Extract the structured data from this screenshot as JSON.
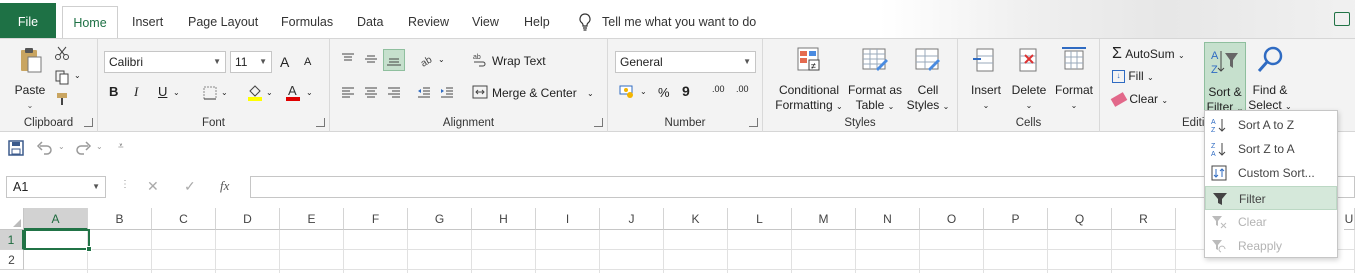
{
  "tabs": {
    "file": "File",
    "home": "Home",
    "insert": "Insert",
    "page_layout": "Page Layout",
    "formulas": "Formulas",
    "data": "Data",
    "review": "Review",
    "view": "View",
    "help": "Help",
    "tell_me": "Tell me what you want to do"
  },
  "clipboard": {
    "paste": "Paste",
    "label": "Clipboard"
  },
  "font": {
    "name": "Calibri",
    "size": "11",
    "bold": "B",
    "italic": "I",
    "underline": "U",
    "grow": "A",
    "shrink": "A",
    "label": "Font"
  },
  "alignment": {
    "wrap_text": "Wrap Text",
    "merge_center": "Merge & Center",
    "label": "Alignment"
  },
  "number": {
    "format": "General",
    "percent": "%",
    "comma": "9",
    "inc_dec": ".00",
    "dec_dec": ".00",
    "label": "Number"
  },
  "styles": {
    "cond_fmt_1": "Conditional",
    "cond_fmt_2": "Formatting",
    "fmt_table_1": "Format as",
    "fmt_table_2": "Table",
    "cell_styles_1": "Cell",
    "cell_styles_2": "Styles",
    "label": "Styles"
  },
  "cells": {
    "insert": "Insert",
    "delete": "Delete",
    "format": "Format",
    "label": "Cells"
  },
  "editing": {
    "autosum": "AutoSum",
    "fill": "Fill",
    "clear": "Clear",
    "sort_1": "Sort &",
    "sort_2": "Filter",
    "find_1": "Find &",
    "find_2": "Select",
    "label": "Editi"
  },
  "formula_bar": {
    "namebox": "A1",
    "fx": "fx"
  },
  "grid": {
    "columns": [
      "A",
      "B",
      "C",
      "D",
      "E",
      "F",
      "G",
      "H",
      "I",
      "J",
      "K",
      "L",
      "M",
      "N",
      "O",
      "P",
      "Q",
      "R",
      "U"
    ],
    "rows": [
      "1",
      "2"
    ]
  },
  "sort_menu": {
    "items": [
      {
        "label": "Sort A to Z",
        "icon": "sort-az-icon",
        "state": "enabled"
      },
      {
        "label": "Sort Z to A",
        "icon": "sort-za-icon",
        "state": "enabled"
      },
      {
        "label": "Custom Sort...",
        "icon": "custom-sort-icon",
        "state": "enabled"
      },
      {
        "label": "Filter",
        "icon": "filter-icon",
        "state": "hover"
      },
      {
        "label": "Clear",
        "icon": "clear-filter-icon",
        "state": "disabled"
      },
      {
        "label": "Reapply",
        "icon": "reapply-icon",
        "state": "disabled"
      }
    ]
  },
  "colors": {
    "accent": "#217346",
    "file_tab": "#1e7145",
    "selection_bg": "#c6e0cd"
  }
}
